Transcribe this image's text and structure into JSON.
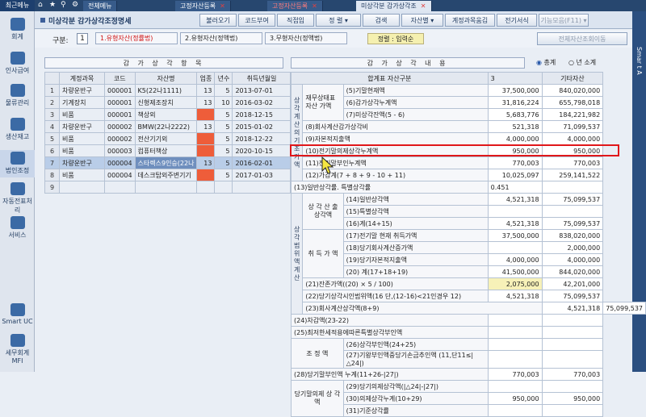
{
  "sidebar": {
    "recent": "최근메뉴",
    "items": [
      "회계",
      "인사급여",
      "물류관리",
      "생산재고",
      "법인조정",
      "자동전표처리",
      "서비스",
      "Smart UC",
      "세무회계MFI"
    ]
  },
  "tabs": {
    "menu": "전체메뉴",
    "t1": "고정자산등록",
    "t2": "고정자산등록",
    "t3": "미상각분 감가상각조"
  },
  "title": "미상각분 감가상각조정명세",
  "toolbar": {
    "b1": "불러오기",
    "b2": "코드부여",
    "b3": "직접입",
    "b4": "정 렬",
    "b5": "검색",
    "b6": "자산별",
    "b7": "계정과목움김",
    "b8": "전기서식",
    "b9": "기능모음(F11)"
  },
  "right_strip": "Smar t A",
  "options": {
    "label": "구분:",
    "value": "1",
    "r1": "1.유형자산(정률법)",
    "r2": "2.유형자산(정액법)",
    "r3": "3.무형자산(정액법)",
    "sort": "정렬 : 입력순",
    "all": "전체자산조회이동"
  },
  "left_panel": {
    "title": "감 가 상 각 항 목",
    "headers": [
      "계정과목",
      "코드",
      "자산명",
      "업종",
      "년수",
      "취득년월일"
    ],
    "rows": [
      {
        "n": "1",
        "acc": "차량운반구",
        "code": "000001",
        "name": "K5(22나1111)",
        "ind": "13",
        "yrs": "5",
        "date": "2013-07-01"
      },
      {
        "n": "2",
        "acc": "기계장치",
        "code": "000001",
        "name": "신형제조장치",
        "ind": "13",
        "yrs": "10",
        "date": "2016-03-02"
      },
      {
        "n": "3",
        "acc": "비품",
        "code": "000001",
        "name": "책상외",
        "ind": "",
        "yrs": "5",
        "date": "2018-12-15"
      },
      {
        "n": "4",
        "acc": "차량운반구",
        "code": "000002",
        "name": "BMW(22나2222)",
        "ind": "13",
        "yrs": "5",
        "date": "2015-01-02"
      },
      {
        "n": "5",
        "acc": "비품",
        "code": "000002",
        "name": "전산기기외",
        "ind": "",
        "yrs": "5",
        "date": "2018-12-22"
      },
      {
        "n": "6",
        "acc": "비품",
        "code": "000003",
        "name": "컴퓨터책상",
        "ind": "",
        "yrs": "5",
        "date": "2020-10-15"
      },
      {
        "n": "7",
        "acc": "차량운반구",
        "code": "000004",
        "name": "스타렉스9인승(22나",
        "ind": "13",
        "yrs": "5",
        "date": "2016-02-01"
      },
      {
        "n": "8",
        "acc": "비품",
        "code": "000004",
        "name": "데스크탑외주변기기",
        "ind": "",
        "yrs": "5",
        "date": "2017-01-03"
      },
      {
        "n": "9",
        "acc": "",
        "code": "",
        "name": "",
        "ind": "",
        "yrs": "",
        "date": ""
      }
    ]
  },
  "right_panel": {
    "title": "감 가 상 각 내 용",
    "radio1": "총계",
    "radio2": "년 소계",
    "h1": "합계표 자산구분",
    "h2": "3",
    "h3": "기타자산",
    "v1": "상각계산의기초가액",
    "v2": "상각범위액계산",
    "g1": "재무상태표 자산 가액",
    "g2": "상 각 산 출 상각액",
    "g3": "취 득 가 액",
    "g4": "조 정 액",
    "g5": "당기말의제 상 각 액",
    "lines": [
      {
        "l": "(5)기말현재액",
        "a": "37,500,000",
        "b": "840,020,000"
      },
      {
        "l": "(6)감가상각누계액",
        "a": "31,816,224",
        "b": "655,798,018"
      },
      {
        "l": "(7)미상각잔액(5 - 6)",
        "a": "5,683,776",
        "b": "184,221,982"
      },
      {
        "l": "(8)회사계산감가상각비",
        "a": "521,318",
        "b": "71,099,537"
      },
      {
        "l": "(9)자본적지출액",
        "a": "4,000,000",
        "b": "4,000,000"
      },
      {
        "l": "(10)전기말의제상각누계액",
        "a": "950,000",
        "b": "950,000"
      },
      {
        "l": "(11)전기말부인누계액",
        "a": "770,003",
        "b": "770,003"
      },
      {
        "l": "(12)가감계(7 + 8 + 9 - 10 + 11)",
        "a": "10,025,097",
        "b": "259,141,522"
      },
      {
        "l": "(13)일반상각률. 특별상각률",
        "a": "0.451",
        "b": ""
      },
      {
        "l": "(14)일반상각액",
        "a": "4,521,318",
        "b": "75,099,537"
      },
      {
        "l": "(15)특별상각액",
        "a": "",
        "b": ""
      },
      {
        "l": "(16)계(14+15)",
        "a": "4,521,318",
        "b": "75,099,537"
      },
      {
        "l": "(17)전기말 현재 취득가액",
        "a": "37,500,000",
        "b": "838,020,000"
      },
      {
        "l": "(18)당기회사계산증가액",
        "a": "",
        "b": "2,000,000"
      },
      {
        "l": "(19)당기자본적지출액",
        "a": "4,000,000",
        "b": "4,000,000"
      },
      {
        "l": "(20) 계(17+18+19)",
        "a": "41,500,000",
        "b": "844,020,000"
      },
      {
        "l": "(21)잔존가액((20) × 5 / 100)",
        "a": "2,075,000",
        "b": "42,201,000"
      },
      {
        "l": "(22)당기상각시인범위액(16 단,(12-16)<21인경우 12)",
        "a": "4,521,318",
        "b": "75,099,537"
      },
      {
        "l": "(23)회사계산상각액(8+9)",
        "a": "4,521,318",
        "b": "75,099,537"
      },
      {
        "l": "(24)차감액(23-22)",
        "a": "",
        "b": ""
      },
      {
        "l": "(25)최저한세적용에따른특별상각부인액",
        "a": "",
        "b": ""
      },
      {
        "l": "(26)상각부인액(24+25)",
        "a": "",
        "b": ""
      },
      {
        "l": "(27)기왕부인액중당기손금추인액 (11,단11≤|△24|)",
        "a": "",
        "b": ""
      },
      {
        "l": "(28)당기말부인액 누계(11+26-|27|)",
        "a": "770,003",
        "b": "770,003"
      },
      {
        "l": "(29)당기의제상각액(|△24|-|27|)",
        "a": "",
        "b": ""
      },
      {
        "l": "(30)의제상각누계(10+29)",
        "a": "950,000",
        "b": "950,000"
      },
      {
        "l": "(31)기준상각률",
        "a": "",
        "b": ""
      }
    ]
  }
}
